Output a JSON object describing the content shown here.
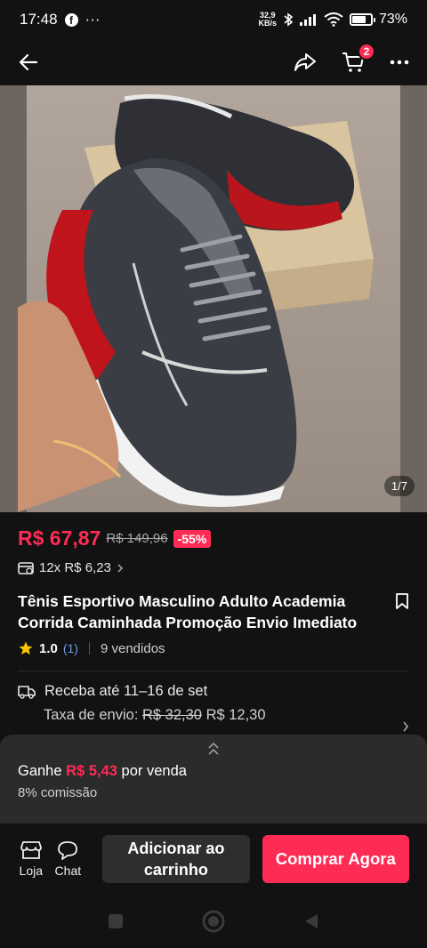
{
  "status_bar": {
    "time": "17:48",
    "more": "···",
    "speed_top": "32,9",
    "speed_bottom": "KB/s",
    "battery": "73%",
    "battery_level": 0.73
  },
  "nav": {
    "cart_count": "2"
  },
  "product": {
    "image_counter": "1/7",
    "price": "R$ 67,87",
    "old_price": "R$ 149,96",
    "discount": "-55%",
    "installment": "12x R$ 6,23",
    "title": "Tênis Esportivo Masculino Adulto Academia Corrida Caminhada Promoção Envio Imediato",
    "rating": "1.0",
    "rating_count": "(1)",
    "sold": "9 vendidos"
  },
  "shipping": {
    "delivery": "Receba até 11–16 de set",
    "fee_label": "Taxa de envio:",
    "fee_old": "R$ 32,30",
    "fee_new": "R$ 12,30"
  },
  "commission": {
    "earn_prefix": "Ganhe",
    "earn_amount": "R$ 5,43",
    "earn_suffix": "por venda",
    "rate": "8% comissão"
  },
  "actions": {
    "store_label": "Loja",
    "chat_label": "Chat",
    "add_to_cart_line1": "Adicionar ao",
    "add_to_cart_line2": "carrinho",
    "buy_now": "Comprar Agora"
  },
  "colors": {
    "accent": "#fe2c55",
    "background": "#121212",
    "sheet": "#2b2b2b"
  }
}
